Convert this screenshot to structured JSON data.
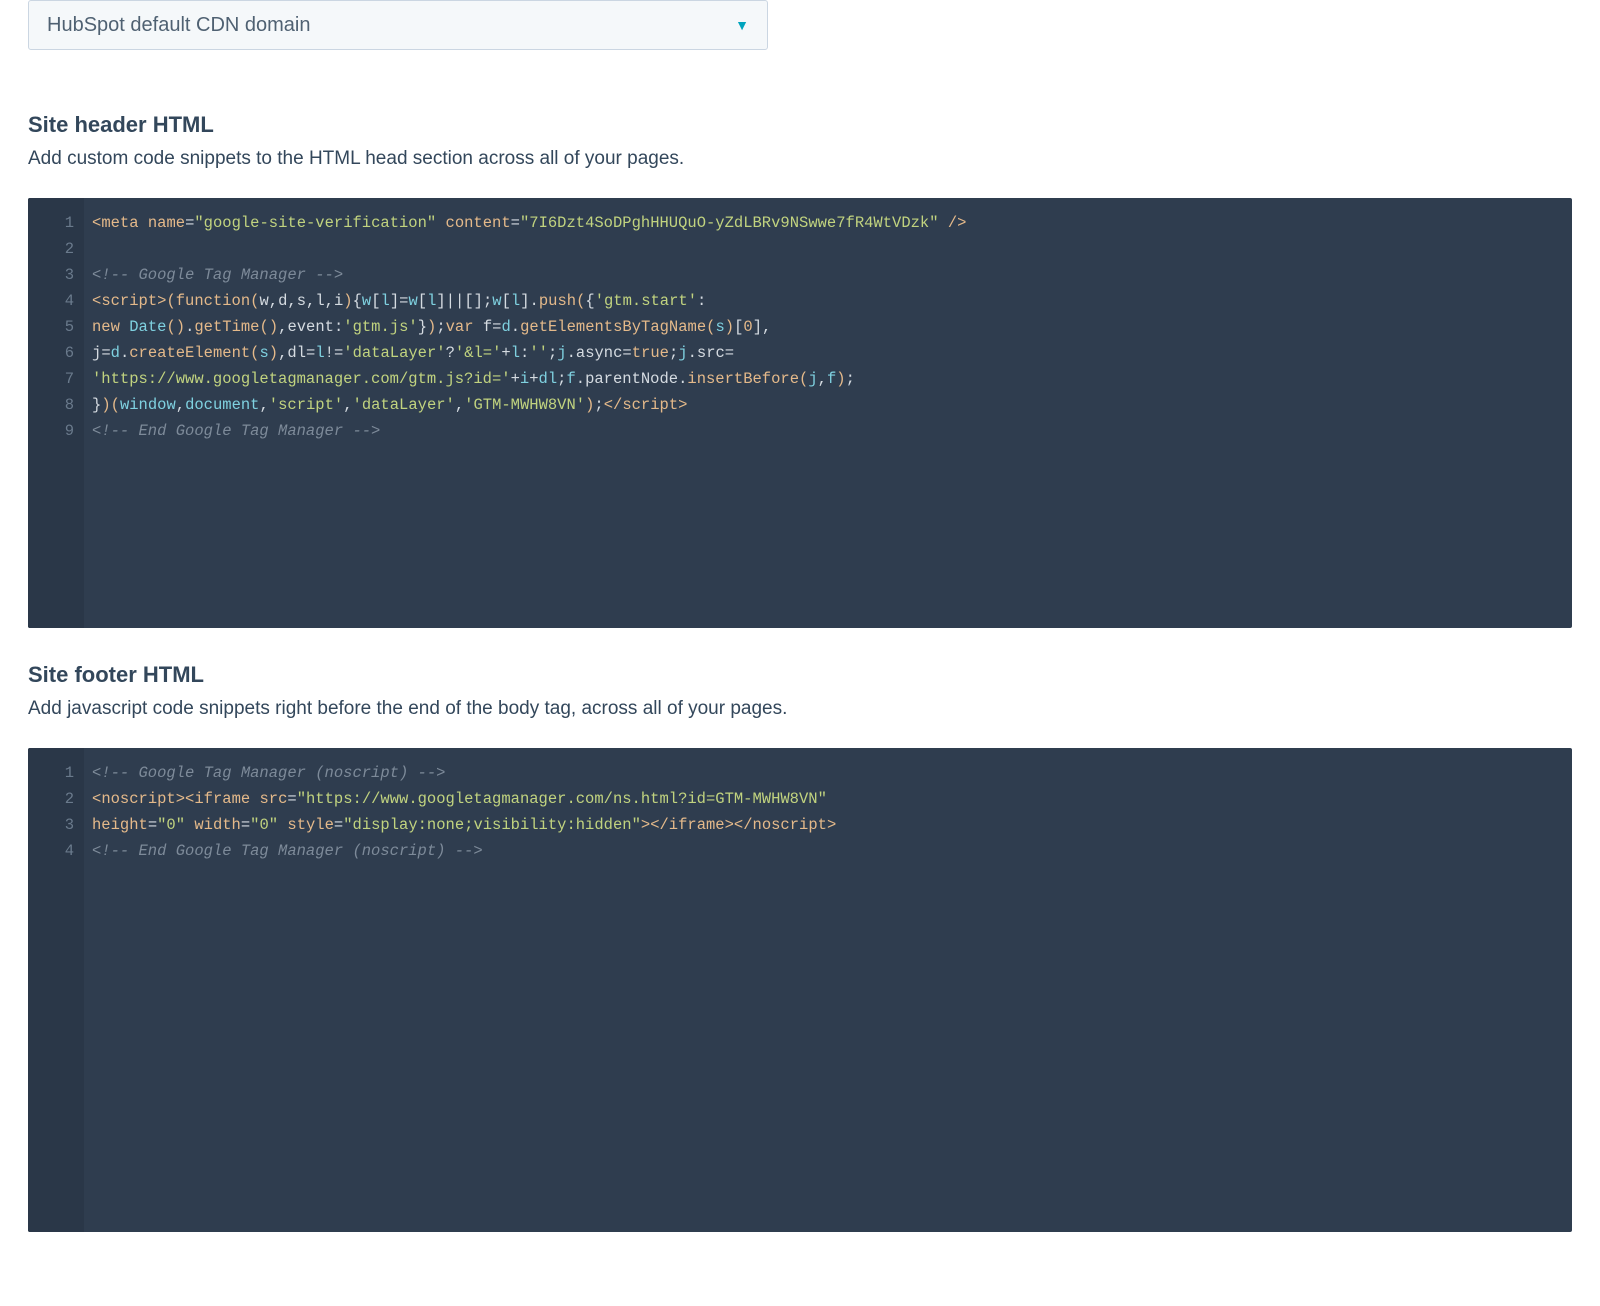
{
  "dropdown": {
    "selected": "HubSpot default CDN domain"
  },
  "header_section": {
    "title": "Site header HTML",
    "description": "Add custom code snippets to the HTML head section across all of your pages.",
    "line_numbers": [
      "1",
      "2",
      "3",
      "4",
      "5",
      "6",
      "7",
      "8",
      "9"
    ],
    "raw_code": "<meta name=\"google-site-verification\" content=\"7I6Dzt4SoDPghHHUQuO-yZdLBRv9NSwwe7fR4WtVDzk\" />\n\n<!-- Google Tag Manager -->\n<script>(function(w,d,s,l,i){w[l]=w[l]||[];w[l].push({'gtm.start':\nnew Date().getTime(),event:'gtm.js'});var f=d.getElementsByTagName(s)[0],\nj=d.createElement(s),dl=l!='dataLayer'?'&l='+l:'';j.async=true;j.src=\n'https://www.googletagmanager.com/gtm.js?id='+i+dl;f.parentNode.insertBefore(j,f);\n})(window,document,'script','dataLayer','GTM-MWHW8VN');</script>\n<!-- End Google Tag Manager -->",
    "tokens": [
      [
        {
          "t": "<",
          "c": "t-tag"
        },
        {
          "t": "meta",
          "c": "t-tag"
        },
        {
          "t": " ",
          "c": ""
        },
        {
          "t": "name",
          "c": "t-attr"
        },
        {
          "t": "=",
          "c": "t-punc"
        },
        {
          "t": "\"google-site-verification\"",
          "c": "t-string"
        },
        {
          "t": " ",
          "c": ""
        },
        {
          "t": "content",
          "c": "t-attr"
        },
        {
          "t": "=",
          "c": "t-punc"
        },
        {
          "t": "\"7I6Dzt4SoDPghHHUQuO-yZdLBRv9NSwwe7fR4WtVDzk\"",
          "c": "t-string"
        },
        {
          "t": " />",
          "c": "t-tag"
        }
      ],
      [],
      [
        {
          "t": "<!-- Google Tag Manager -->",
          "c": "t-comment"
        }
      ],
      [
        {
          "t": "<",
          "c": "t-tag"
        },
        {
          "t": "script",
          "c": "t-tag"
        },
        {
          "t": ">",
          "c": "t-tag"
        },
        {
          "t": "(",
          "c": "t-paren"
        },
        {
          "t": "function",
          "c": "t-keyword"
        },
        {
          "t": "(",
          "c": "t-paren"
        },
        {
          "t": "w",
          "c": "t-prop"
        },
        {
          "t": ",",
          "c": "t-punc"
        },
        {
          "t": "d",
          "c": "t-prop"
        },
        {
          "t": ",",
          "c": "t-punc"
        },
        {
          "t": "s",
          "c": "t-prop"
        },
        {
          "t": ",",
          "c": "t-punc"
        },
        {
          "t": "l",
          "c": "t-prop"
        },
        {
          "t": ",",
          "c": "t-punc"
        },
        {
          "t": "i",
          "c": "t-prop"
        },
        {
          "t": ")",
          "c": "t-paren"
        },
        {
          "t": "{",
          "c": "t-punc"
        },
        {
          "t": "w",
          "c": "t-blue"
        },
        {
          "t": "[",
          "c": "t-punc"
        },
        {
          "t": "l",
          "c": "t-blue"
        },
        {
          "t": "]",
          "c": "t-punc"
        },
        {
          "t": "=",
          "c": "t-punc"
        },
        {
          "t": "w",
          "c": "t-blue"
        },
        {
          "t": "[",
          "c": "t-punc"
        },
        {
          "t": "l",
          "c": "t-blue"
        },
        {
          "t": "]",
          "c": "t-punc"
        },
        {
          "t": "||",
          "c": "t-punc"
        },
        {
          "t": "[",
          "c": "t-punc"
        },
        {
          "t": "]",
          "c": "t-punc"
        },
        {
          "t": ";",
          "c": "t-punc"
        },
        {
          "t": "w",
          "c": "t-blue"
        },
        {
          "t": "[",
          "c": "t-punc"
        },
        {
          "t": "l",
          "c": "t-blue"
        },
        {
          "t": "]",
          "c": "t-punc"
        },
        {
          "t": ".",
          "c": "t-punc"
        },
        {
          "t": "push",
          "c": "t-func"
        },
        {
          "t": "(",
          "c": "t-paren"
        },
        {
          "t": "{",
          "c": "t-punc"
        },
        {
          "t": "'gtm.start'",
          "c": "t-string"
        },
        {
          "t": ":",
          "c": "t-punc"
        }
      ],
      [
        {
          "t": "new",
          "c": "t-keyword"
        },
        {
          "t": " ",
          "c": ""
        },
        {
          "t": "Date",
          "c": "t-blue"
        },
        {
          "t": "(",
          "c": "t-paren"
        },
        {
          "t": ")",
          "c": "t-paren"
        },
        {
          "t": ".",
          "c": "t-punc"
        },
        {
          "t": "getTime",
          "c": "t-func"
        },
        {
          "t": "(",
          "c": "t-paren"
        },
        {
          "t": ")",
          "c": "t-paren"
        },
        {
          "t": ",",
          "c": "t-punc"
        },
        {
          "t": "event",
          "c": "t-prop"
        },
        {
          "t": ":",
          "c": "t-punc"
        },
        {
          "t": "'gtm.js'",
          "c": "t-string"
        },
        {
          "t": "}",
          "c": "t-punc"
        },
        {
          "t": ")",
          "c": "t-paren"
        },
        {
          "t": ";",
          "c": "t-punc"
        },
        {
          "t": "var",
          "c": "t-keyword"
        },
        {
          "t": " ",
          "c": ""
        },
        {
          "t": "f",
          "c": "t-prop"
        },
        {
          "t": "=",
          "c": "t-punc"
        },
        {
          "t": "d",
          "c": "t-blue"
        },
        {
          "t": ".",
          "c": "t-punc"
        },
        {
          "t": "getElementsByTagName",
          "c": "t-func"
        },
        {
          "t": "(",
          "c": "t-paren"
        },
        {
          "t": "s",
          "c": "t-blue"
        },
        {
          "t": ")",
          "c": "t-paren"
        },
        {
          "t": "[",
          "c": "t-punc"
        },
        {
          "t": "0",
          "c": "t-num"
        },
        {
          "t": "]",
          "c": "t-punc"
        },
        {
          "t": ",",
          "c": "t-punc"
        }
      ],
      [
        {
          "t": "j",
          "c": "t-prop"
        },
        {
          "t": "=",
          "c": "t-punc"
        },
        {
          "t": "d",
          "c": "t-blue"
        },
        {
          "t": ".",
          "c": "t-punc"
        },
        {
          "t": "createElement",
          "c": "t-func"
        },
        {
          "t": "(",
          "c": "t-paren"
        },
        {
          "t": "s",
          "c": "t-blue"
        },
        {
          "t": ")",
          "c": "t-paren"
        },
        {
          "t": ",",
          "c": "t-punc"
        },
        {
          "t": "dl",
          "c": "t-prop"
        },
        {
          "t": "=",
          "c": "t-punc"
        },
        {
          "t": "l",
          "c": "t-blue"
        },
        {
          "t": "!=",
          "c": "t-punc"
        },
        {
          "t": "'dataLayer'",
          "c": "t-string"
        },
        {
          "t": "?",
          "c": "t-punc"
        },
        {
          "t": "'&l='",
          "c": "t-string"
        },
        {
          "t": "+",
          "c": "t-punc"
        },
        {
          "t": "l",
          "c": "t-blue"
        },
        {
          "t": ":",
          "c": "t-punc"
        },
        {
          "t": "''",
          "c": "t-string"
        },
        {
          "t": ";",
          "c": "t-punc"
        },
        {
          "t": "j",
          "c": "t-blue"
        },
        {
          "t": ".",
          "c": "t-punc"
        },
        {
          "t": "async",
          "c": "t-prop"
        },
        {
          "t": "=",
          "c": "t-punc"
        },
        {
          "t": "true",
          "c": "t-keyword"
        },
        {
          "t": ";",
          "c": "t-punc"
        },
        {
          "t": "j",
          "c": "t-blue"
        },
        {
          "t": ".",
          "c": "t-punc"
        },
        {
          "t": "src",
          "c": "t-prop"
        },
        {
          "t": "=",
          "c": "t-punc"
        }
      ],
      [
        {
          "t": "'https://www.googletagmanager.com/gtm.js?id='",
          "c": "t-string"
        },
        {
          "t": "+",
          "c": "t-punc"
        },
        {
          "t": "i",
          "c": "t-blue"
        },
        {
          "t": "+",
          "c": "t-punc"
        },
        {
          "t": "dl",
          "c": "t-blue"
        },
        {
          "t": ";",
          "c": "t-punc"
        },
        {
          "t": "f",
          "c": "t-blue"
        },
        {
          "t": ".",
          "c": "t-punc"
        },
        {
          "t": "parentNode",
          "c": "t-prop"
        },
        {
          "t": ".",
          "c": "t-punc"
        },
        {
          "t": "insertBefore",
          "c": "t-func"
        },
        {
          "t": "(",
          "c": "t-paren"
        },
        {
          "t": "j",
          "c": "t-blue"
        },
        {
          "t": ",",
          "c": "t-punc"
        },
        {
          "t": "f",
          "c": "t-blue"
        },
        {
          "t": ")",
          "c": "t-paren"
        },
        {
          "t": ";",
          "c": "t-punc"
        }
      ],
      [
        {
          "t": "}",
          "c": "t-punc"
        },
        {
          "t": ")",
          "c": "t-paren"
        },
        {
          "t": "(",
          "c": "t-paren"
        },
        {
          "t": "window",
          "c": "t-blue"
        },
        {
          "t": ",",
          "c": "t-punc"
        },
        {
          "t": "document",
          "c": "t-blue"
        },
        {
          "t": ",",
          "c": "t-punc"
        },
        {
          "t": "'script'",
          "c": "t-string"
        },
        {
          "t": ",",
          "c": "t-punc"
        },
        {
          "t": "'dataLayer'",
          "c": "t-string"
        },
        {
          "t": ",",
          "c": "t-punc"
        },
        {
          "t": "'GTM-MWHW8VN'",
          "c": "t-string"
        },
        {
          "t": ")",
          "c": "t-paren"
        },
        {
          "t": ";",
          "c": "t-punc"
        },
        {
          "t": "</",
          "c": "t-tag"
        },
        {
          "t": "script",
          "c": "t-tag"
        },
        {
          "t": ">",
          "c": "t-tag"
        }
      ],
      [
        {
          "t": "<!-- End Google Tag Manager -->",
          "c": "t-comment"
        }
      ]
    ]
  },
  "footer_section": {
    "title": "Site footer HTML",
    "description": "Add javascript code snippets right before the end of the body tag, across all of your pages.",
    "line_numbers": [
      "1",
      "2",
      "3",
      "4"
    ],
    "raw_code": "<!-- Google Tag Manager (noscript) -->\n<noscript><iframe src=\"https://www.googletagmanager.com/ns.html?id=GTM-MWHW8VN\"\nheight=\"0\" width=\"0\" style=\"display:none;visibility:hidden\"></iframe></noscript>\n<!-- End Google Tag Manager (noscript) -->",
    "tokens": [
      [
        {
          "t": "<!-- Google Tag Manager (noscript) -->",
          "c": "t-comment"
        }
      ],
      [
        {
          "t": "<",
          "c": "t-tag"
        },
        {
          "t": "noscript",
          "c": "t-tag"
        },
        {
          "t": ">",
          "c": "t-tag"
        },
        {
          "t": "<",
          "c": "t-tag"
        },
        {
          "t": "iframe",
          "c": "t-tag"
        },
        {
          "t": " ",
          "c": ""
        },
        {
          "t": "src",
          "c": "t-attr"
        },
        {
          "t": "=",
          "c": "t-punc"
        },
        {
          "t": "\"https://www.googletagmanager.com/ns.html?id=GTM-MWHW8VN\"",
          "c": "t-string"
        }
      ],
      [
        {
          "t": "height",
          "c": "t-attr"
        },
        {
          "t": "=",
          "c": "t-punc"
        },
        {
          "t": "\"0\"",
          "c": "t-string"
        },
        {
          "t": " ",
          "c": ""
        },
        {
          "t": "width",
          "c": "t-attr"
        },
        {
          "t": "=",
          "c": "t-punc"
        },
        {
          "t": "\"0\"",
          "c": "t-string"
        },
        {
          "t": " ",
          "c": ""
        },
        {
          "t": "style",
          "c": "t-attr"
        },
        {
          "t": "=",
          "c": "t-punc"
        },
        {
          "t": "\"display:none;visibility:hidden\"",
          "c": "t-string"
        },
        {
          "t": ">",
          "c": "t-tag"
        },
        {
          "t": "</",
          "c": "t-tag"
        },
        {
          "t": "iframe",
          "c": "t-tag"
        },
        {
          "t": ">",
          "c": "t-tag"
        },
        {
          "t": "</",
          "c": "t-tag"
        },
        {
          "t": "noscript",
          "c": "t-tag"
        },
        {
          "t": ">",
          "c": "t-tag"
        }
      ],
      [
        {
          "t": "<!-- End Google Tag Manager (noscript) -->",
          "c": "t-comment"
        }
      ]
    ]
  }
}
